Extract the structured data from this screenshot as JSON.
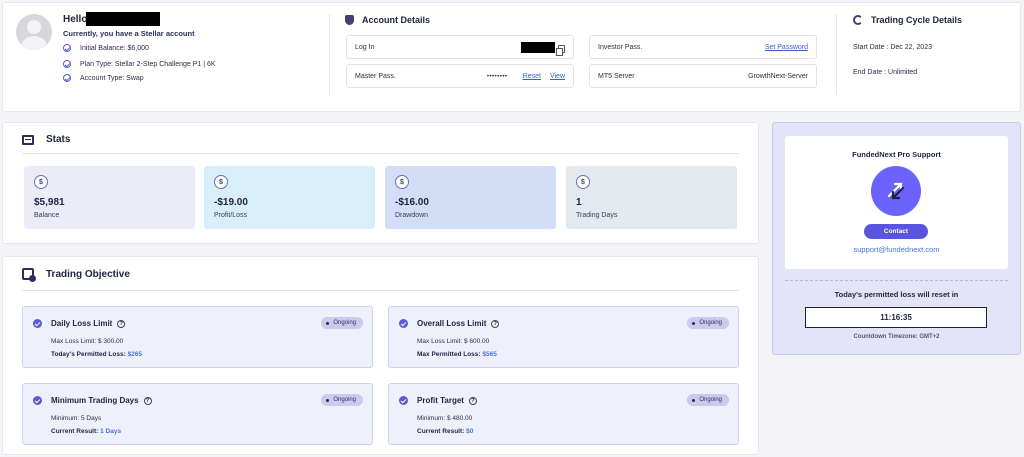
{
  "header": {
    "hello": "Hello",
    "subtitle": "Currently, you have a Stellar account",
    "initial_balance": "Initial Balance: $6,000",
    "plan_type": "Plan Type: Stellar 2-Step Challenge P1 | 6K",
    "account_type": "Account Type: Swap"
  },
  "account_details": {
    "title": "Account Details",
    "login_label": "Log In",
    "master_label": "Master Pass.",
    "master_masked": "••••••••",
    "reset": "Reset",
    "view": "View",
    "investor_label": "Investor Pass.",
    "set_password": "Set Password",
    "server_label": "MT5 Server",
    "server_value": "GrowthNext-Server"
  },
  "trading_cycle": {
    "title": "Trading Cycle Details",
    "start": "Start Date : Dec 22, 2023",
    "end": "End Date : Unlimited"
  },
  "stats": {
    "title": "Stats",
    "items": [
      {
        "value": "$5,981",
        "label": "Balance",
        "color": "#ececf8"
      },
      {
        "value": "-$19.00",
        "label": "Profit/Loss",
        "color": "#d8eef8"
      },
      {
        "value": "-$16.00",
        "label": "Drawdown",
        "color": "#d3ddf6"
      },
      {
        "value": "1",
        "label": "Trading Days",
        "color": "#e2e9ef"
      }
    ]
  },
  "support": {
    "title": "FundedNext Pro Support",
    "contact": "Contact",
    "email": "support@fundednext.com",
    "reset_title": "Today's permitted loss will reset in",
    "timer": "11:16:35",
    "timezone": "Countdown Timezone: GMT+2"
  },
  "objectives": {
    "title": "Trading Objective",
    "status": "Ongoing",
    "daily": {
      "title": "Daily Loss Limit",
      "l1": "Max Loss Limit: $ 300.00",
      "l2_label": "Today's Permitted Loss:",
      "l2_value": "$265"
    },
    "overall": {
      "title": "Overall Loss Limit",
      "l1": "Max Loss Limit: $ 600.00",
      "l2_label": "Max Permitted Loss:",
      "l2_value": "$565"
    },
    "min_days": {
      "title": "Minimum Trading Days",
      "l1": "Minimum: 5 Days",
      "l2_label": "Current Result:",
      "l2_value": "1 Days"
    },
    "profit": {
      "title": "Profit Target",
      "l1": "Minimum: $ 480.00",
      "l2_label": "Current Result:",
      "l2_value": "$0"
    }
  }
}
